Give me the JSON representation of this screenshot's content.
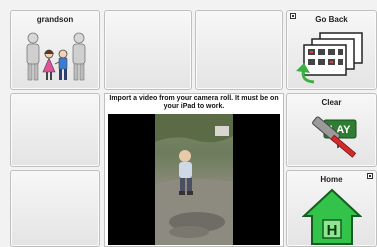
{
  "cells": {
    "grandson": {
      "label": "grandson"
    },
    "go_back": {
      "label": "Go Back"
    },
    "clear": {
      "label": "Clear",
      "sign_text": "LAY"
    },
    "home": {
      "label": "Home",
      "house_letter": "H"
    }
  },
  "video": {
    "caption": "Import a video from your camera roll. It must be on your iPad to work."
  },
  "colors": {
    "arrow_green": "#3cb043",
    "house_green": "#33c24a",
    "hammer_red": "#d22b2b",
    "sign_green": "#2e7d32"
  },
  "icons": [
    "family-icon",
    "go-back-icon",
    "clear-icon",
    "home-icon",
    "folder-corner-icon"
  ]
}
